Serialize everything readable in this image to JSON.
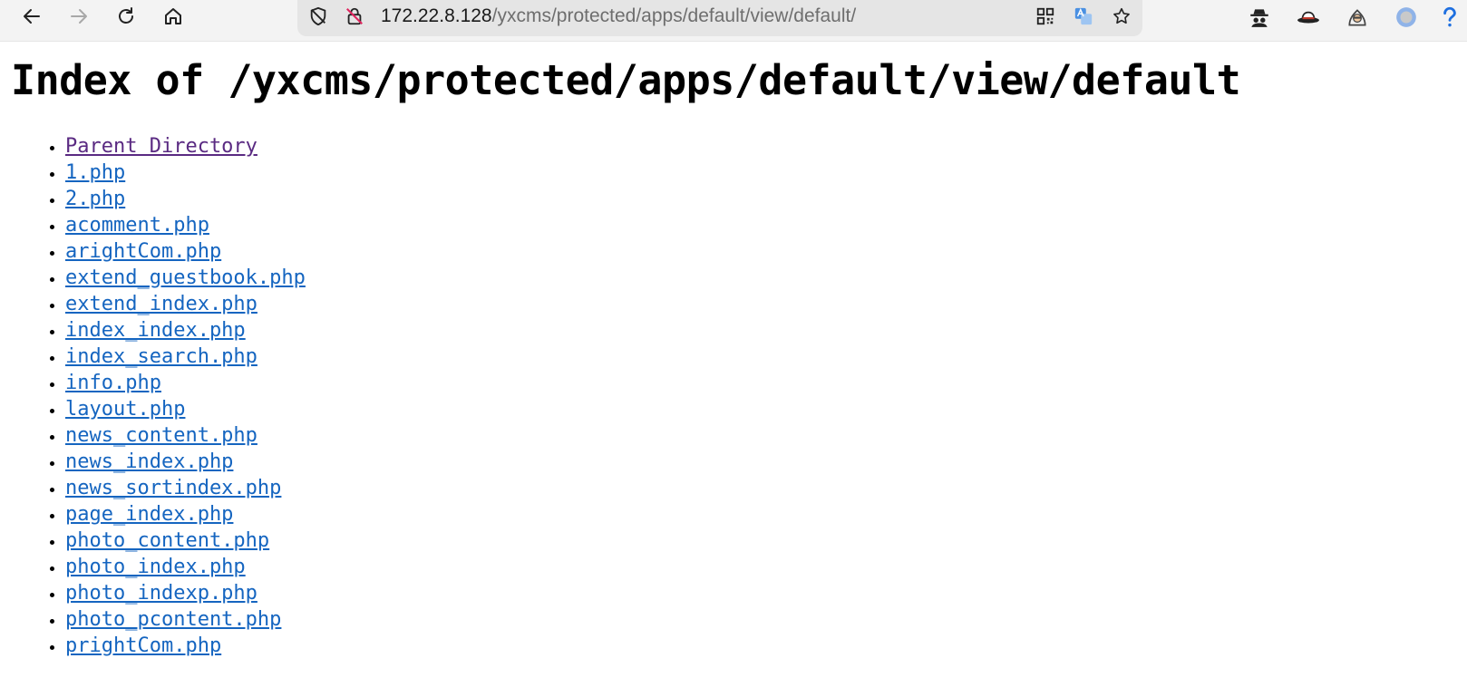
{
  "browser": {
    "url_host": "172.22.8.128",
    "url_path": "/yxcms/protected/apps/default/view/default/"
  },
  "page": {
    "heading": "Index of /yxcms/protected/apps/default/view/default",
    "entries": [
      {
        "label": "Parent Directory",
        "visited": true
      },
      {
        "label": "1.php"
      },
      {
        "label": "2.php"
      },
      {
        "label": "acomment.php"
      },
      {
        "label": "arightCom.php"
      },
      {
        "label": "extend_guestbook.php"
      },
      {
        "label": "extend_index.php"
      },
      {
        "label": "index_index.php"
      },
      {
        "label": "index_search.php"
      },
      {
        "label": "info.php"
      },
      {
        "label": "layout.php"
      },
      {
        "label": "news_content.php"
      },
      {
        "label": "news_index.php"
      },
      {
        "label": "news_sortindex.php"
      },
      {
        "label": "page_index.php"
      },
      {
        "label": "photo_content.php"
      },
      {
        "label": "photo_index.php"
      },
      {
        "label": "photo_indexp.php"
      },
      {
        "label": "photo_pcontent.php"
      },
      {
        "label": "prightCom.php"
      }
    ]
  },
  "colors": {
    "link": "#1565c0",
    "visited_link": "#5a2a82",
    "toolbar_bg": "#f3f3f3",
    "address_bg": "#e5e5e5"
  },
  "icons": [
    "back-icon",
    "forward-icon",
    "reload-icon",
    "home-icon",
    "tracking-shield-icon",
    "insecure-lock-icon",
    "qr-code-icon",
    "translate-icon",
    "favorite-star-icon",
    "extension-spy-icon",
    "extension-hat-icon",
    "extension-hacker-icon",
    "extension-circle-icon",
    "help-icon"
  ]
}
